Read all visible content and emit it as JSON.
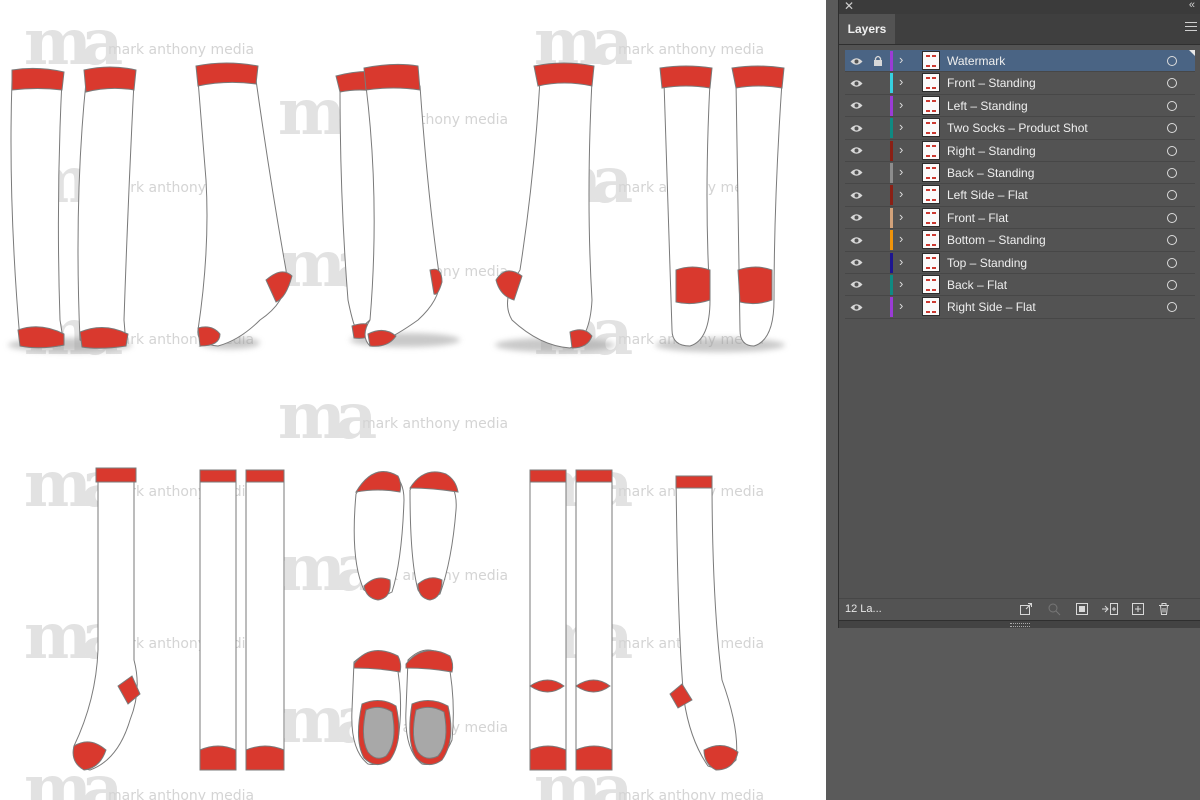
{
  "canvas": {
    "watermark_text": "mark anthony media",
    "watermark_logo": "ma",
    "sock_color": "#d9392e",
    "sole_gray": "#a8a8a8"
  },
  "panel": {
    "title": "Layers",
    "close_icon": "close-icon",
    "collapse_icon": "collapse-icon",
    "menu_icon": "hamburger-menu-icon",
    "layer_count": "12 La...",
    "footer_icons": [
      "export-icon",
      "search-icon",
      "make-clipping-mask-icon",
      "collect-in-new-layer-icon",
      "new-layer-icon",
      "trash-icon"
    ],
    "layers": [
      {
        "name": "Watermark",
        "color": "#9b3bd6",
        "selected": true,
        "locked": true
      },
      {
        "name": "Front – Standing",
        "color": "#36d0e0",
        "selected": false,
        "locked": false
      },
      {
        "name": "Left – Standing",
        "color": "#9b3bd6",
        "selected": false,
        "locked": false
      },
      {
        "name": "Two Socks – Product Shot",
        "color": "#0f8a82",
        "selected": false,
        "locked": false
      },
      {
        "name": "Right – Standing",
        "color": "#8a1f14",
        "selected": false,
        "locked": false
      },
      {
        "name": "Back – Standing",
        "color": "#8c8c8c",
        "selected": false,
        "locked": false
      },
      {
        "name": "Left Side – Flat",
        "color": "#8a1f14",
        "selected": false,
        "locked": false
      },
      {
        "name": "Front – Flat",
        "color": "#d2a27a",
        "selected": false,
        "locked": false
      },
      {
        "name": "Bottom – Standing",
        "color": "#f0940a",
        "selected": false,
        "locked": false
      },
      {
        "name": "Top – Standing",
        "color": "#1d1590",
        "selected": false,
        "locked": false
      },
      {
        "name": "Back – Flat",
        "color": "#0f8a82",
        "selected": false,
        "locked": false
      },
      {
        "name": "Right Side – Flat",
        "color": "#9b3bd6",
        "selected": false,
        "locked": false
      }
    ]
  }
}
